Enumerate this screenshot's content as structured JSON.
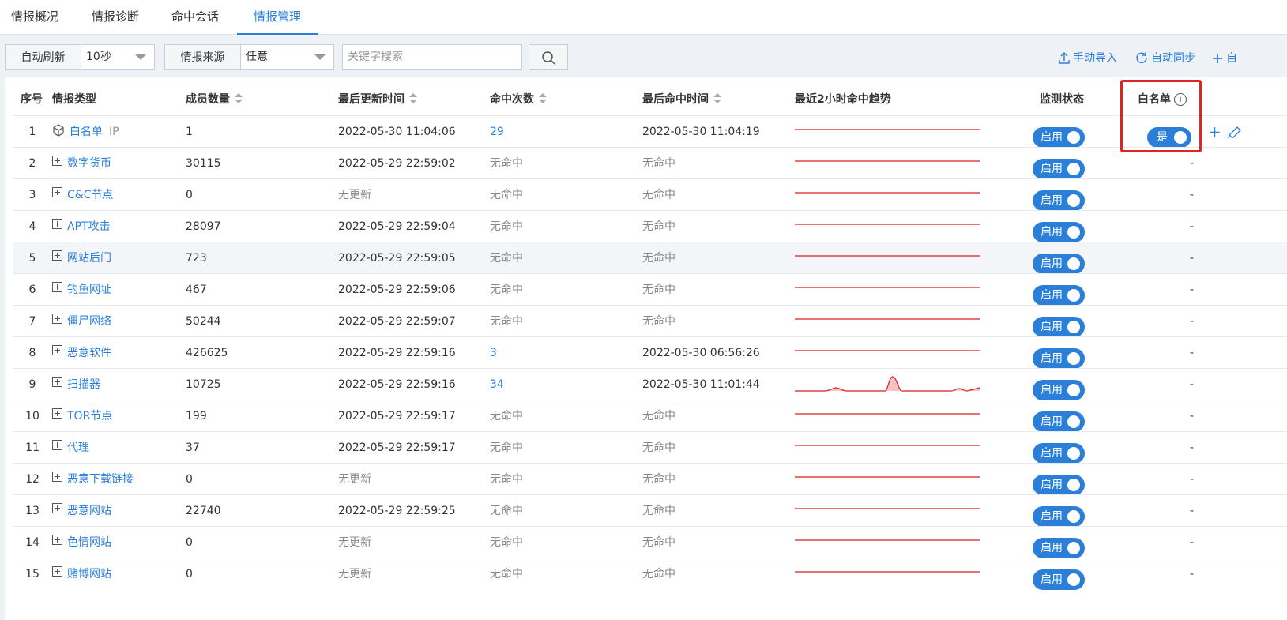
{
  "tabs": [
    {
      "label": "情报概况",
      "active": false
    },
    {
      "label": "情报诊断",
      "active": false
    },
    {
      "label": "命中会话",
      "active": false
    },
    {
      "label": "情报管理",
      "active": true
    }
  ],
  "toolbar": {
    "auto_refresh_label": "自动刷新",
    "auto_refresh_value": "10秒",
    "source_label": "情报来源",
    "source_value": "任意",
    "search_placeholder": "关键字搜索",
    "import_label": "手动导入",
    "sync_label": "自动同步",
    "add_label": "自"
  },
  "table": {
    "headers": {
      "idx": "序号",
      "type": "情报类型",
      "members": "成员数量",
      "updated": "最后更新时间",
      "hits": "命中次数",
      "last_hit": "最后命中时间",
      "trend": "最近2小时命中趋势",
      "monitor": "监测状态",
      "whitelist": "白名单"
    },
    "monitor_on": "启用",
    "whitelist_yes": "是",
    "rows": [
      {
        "idx": "1",
        "type": "白名单",
        "tag": "IP",
        "members": "1",
        "updated": "2022-05-30 11:04:06",
        "hits": "29",
        "last_hit": "2022-05-30 11:04:19",
        "whitelist": "是"
      },
      {
        "idx": "2",
        "type": "数字货币",
        "members": "30115",
        "updated": "2022-05-29 22:59:02",
        "hits": "无命中",
        "last_hit": "无命中",
        "whitelist": "-"
      },
      {
        "idx": "3",
        "type": "C&C节点",
        "members": "0",
        "updated": "无更新",
        "hits": "无命中",
        "last_hit": "无命中",
        "whitelist": "-"
      },
      {
        "idx": "4",
        "type": "APT攻击",
        "members": "28097",
        "updated": "2022-05-29 22:59:04",
        "hits": "无命中",
        "last_hit": "无命中",
        "whitelist": "-"
      },
      {
        "idx": "5",
        "type": "网站后门",
        "members": "723",
        "updated": "2022-05-29 22:59:05",
        "hits": "无命中",
        "last_hit": "无命中",
        "whitelist": "-"
      },
      {
        "idx": "6",
        "type": "钓鱼网址",
        "members": "467",
        "updated": "2022-05-29 22:59:06",
        "hits": "无命中",
        "last_hit": "无命中",
        "whitelist": "-"
      },
      {
        "idx": "7",
        "type": "僵尸网络",
        "members": "50244",
        "updated": "2022-05-29 22:59:07",
        "hits": "无命中",
        "last_hit": "无命中",
        "whitelist": "-"
      },
      {
        "idx": "8",
        "type": "恶意软件",
        "members": "426625",
        "updated": "2022-05-29 22:59:16",
        "hits": "3",
        "last_hit": "2022-05-30 06:56:26",
        "whitelist": "-"
      },
      {
        "idx": "9",
        "type": "扫描器",
        "members": "10725",
        "updated": "2022-05-29 22:59:16",
        "hits": "34",
        "last_hit": "2022-05-30 11:01:44",
        "whitelist": "-"
      },
      {
        "idx": "10",
        "type": "TOR节点",
        "members": "199",
        "updated": "2022-05-29 22:59:17",
        "hits": "无命中",
        "last_hit": "无命中",
        "whitelist": "-"
      },
      {
        "idx": "11",
        "type": "代理",
        "members": "37",
        "updated": "2022-05-29 22:59:17",
        "hits": "无命中",
        "last_hit": "无命中",
        "whitelist": "-"
      },
      {
        "idx": "12",
        "type": "恶意下载链接",
        "members": "0",
        "updated": "无更新",
        "hits": "无命中",
        "last_hit": "无命中",
        "whitelist": "-"
      },
      {
        "idx": "13",
        "type": "恶意网站",
        "members": "22740",
        "updated": "2022-05-29 22:59:25",
        "hits": "无命中",
        "last_hit": "无命中",
        "whitelist": "-"
      },
      {
        "idx": "14",
        "type": "色情网站",
        "members": "0",
        "updated": "无更新",
        "hits": "无命中",
        "last_hit": "无命中",
        "whitelist": "-"
      },
      {
        "idx": "15",
        "type": "赌博网站",
        "members": "0",
        "updated": "无更新",
        "hits": "无命中",
        "last_hit": "无命中",
        "whitelist": "-"
      }
    ]
  },
  "colors": {
    "accent": "#2b7fd8",
    "trend_line": "#d81e1e",
    "highlight": "#e02424"
  }
}
